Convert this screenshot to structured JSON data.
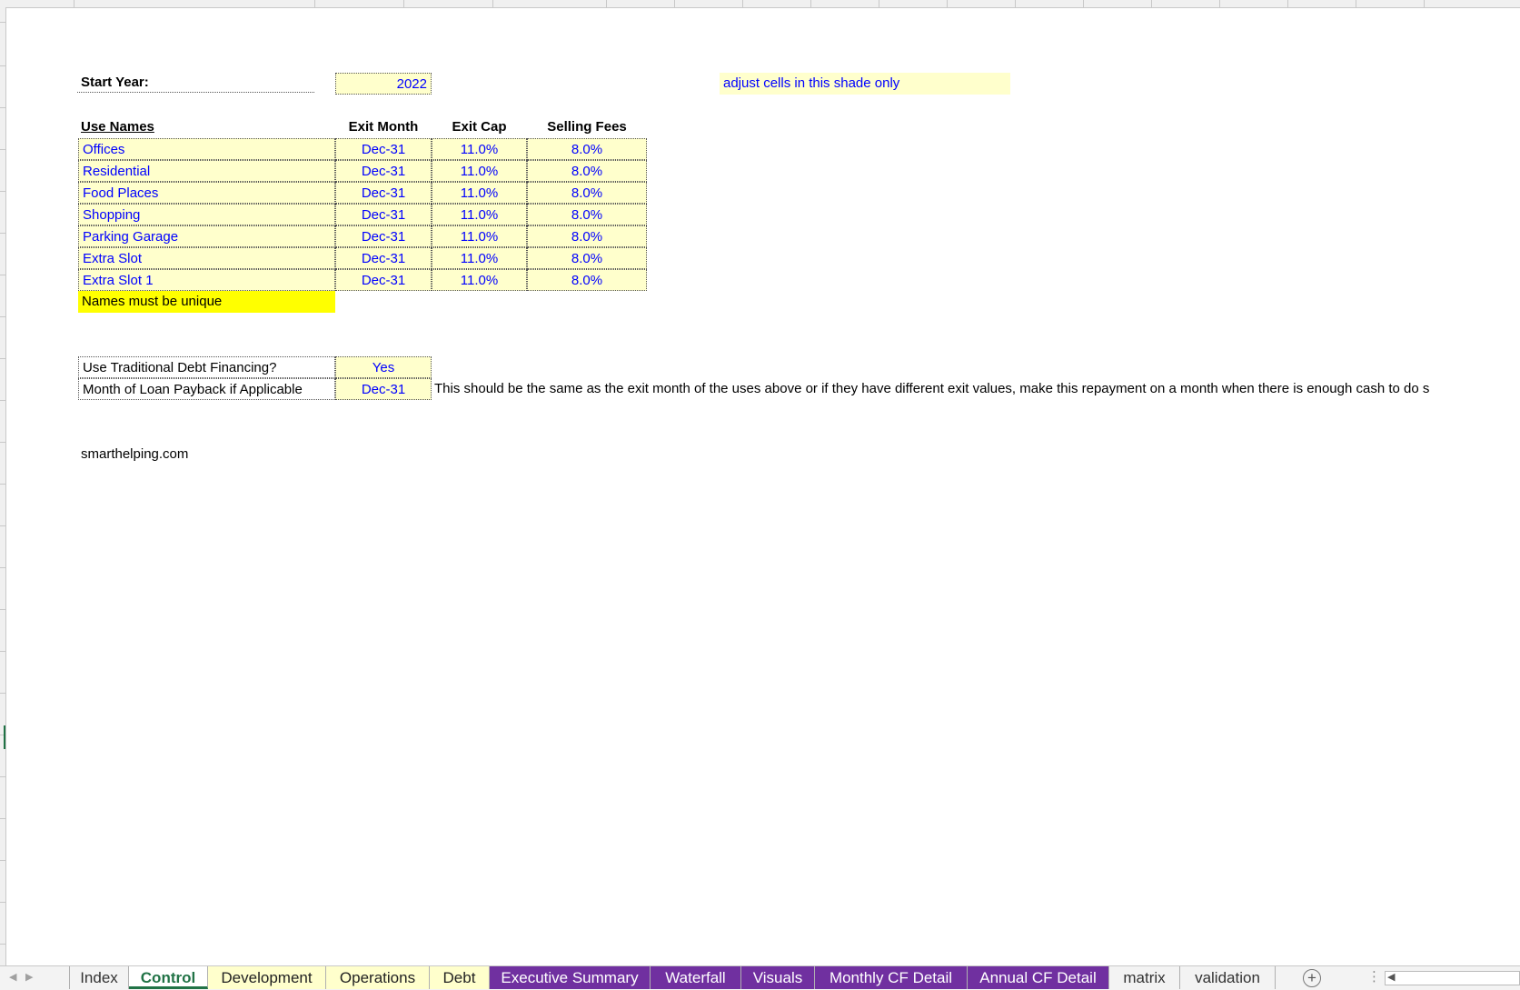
{
  "start_year": {
    "label": "Start Year:",
    "value": "2022"
  },
  "note_shade": "adjust cells in this shade only",
  "uses_table": {
    "headers": [
      "Use Names",
      "Exit Month",
      "Exit Cap",
      "Selling Fees"
    ],
    "rows": [
      {
        "name": "Offices",
        "exit_month": "Dec-31",
        "exit_cap": "11.0%",
        "selling_fees": "8.0%"
      },
      {
        "name": "Residential",
        "exit_month": "Dec-31",
        "exit_cap": "11.0%",
        "selling_fees": "8.0%"
      },
      {
        "name": "Food Places",
        "exit_month": "Dec-31",
        "exit_cap": "11.0%",
        "selling_fees": "8.0%"
      },
      {
        "name": "Shopping",
        "exit_month": "Dec-31",
        "exit_cap": "11.0%",
        "selling_fees": "8.0%"
      },
      {
        "name": "Parking Garage",
        "exit_month": "Dec-31",
        "exit_cap": "11.0%",
        "selling_fees": "8.0%"
      },
      {
        "name": "Extra Slot",
        "exit_month": "Dec-31",
        "exit_cap": "11.0%",
        "selling_fees": "8.0%"
      },
      {
        "name": "Extra Slot 1",
        "exit_month": "Dec-31",
        "exit_cap": "11.0%",
        "selling_fees": "8.0%"
      }
    ],
    "unique_note": "Names must be unique"
  },
  "debt": {
    "financing_label": "Use Traditional Debt Financing?",
    "financing_value": "Yes",
    "payback_label": "Month of Loan Payback if Applicable",
    "payback_value": "Dec-31",
    "payback_note": "This should be the same as the exit month of the uses above or if they have different exit values, make this repayment on a month when there is enough cash to do s"
  },
  "footer_site": "smarthelping.com",
  "sheet_tabs": [
    {
      "label": "Index",
      "style": "plain"
    },
    {
      "label": "Control",
      "style": "active"
    },
    {
      "label": "Development",
      "style": "yellow"
    },
    {
      "label": "Operations",
      "style": "yellow"
    },
    {
      "label": "Debt",
      "style": "yellow"
    },
    {
      "label": "Executive Summary",
      "style": "purple"
    },
    {
      "label": "Waterfall",
      "style": "purple"
    },
    {
      "label": "Visuals",
      "style": "purple"
    },
    {
      "label": "Monthly CF Detail",
      "style": "purple"
    },
    {
      "label": "Annual CF Detail",
      "style": "purple"
    },
    {
      "label": "matrix",
      "style": "plain"
    },
    {
      "label": "validation",
      "style": "plain"
    }
  ],
  "icons": {
    "add_sheet": "plus-circle-icon",
    "more": "vertical-dots-icon",
    "scroll_left": "scroll-left-icon"
  },
  "colors": {
    "input_shade": "#ffffcc",
    "warning_yellow": "#ffff00",
    "input_text": "#0000ff",
    "tab_purple": "#7030a0",
    "excel_green": "#217346"
  }
}
